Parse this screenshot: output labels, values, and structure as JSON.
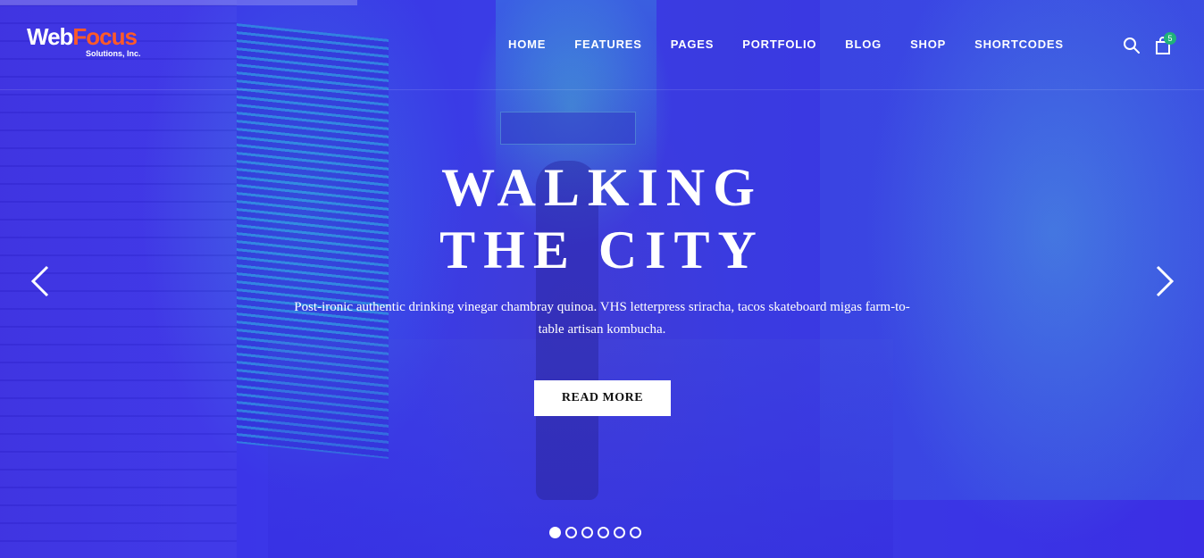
{
  "brand": {
    "name_part1": "Web",
    "name_part2": "Focus",
    "tagline": "Solutions, Inc.",
    "accent_color": "#ff5a28"
  },
  "nav": {
    "items": [
      "HOME",
      "FEATURES",
      "PAGES",
      "PORTFOLIO",
      "BLOG",
      "SHOP",
      "SHORTCODES"
    ]
  },
  "header_icons": {
    "search": "search-icon",
    "cart": "shopping-bag-icon",
    "cart_count": "5",
    "badge_color": "#20b27a"
  },
  "hero": {
    "title_line1": "WALKING",
    "title_line2": "THE CITY",
    "description": "Post-ironic authentic drinking vinegar chambray quinoa. VHS letterpress sriracha, tacos skateboard migas farm-to-table artisan kombucha.",
    "cta_label": "READ MORE",
    "overlay_color": "#3a35e5"
  },
  "slider": {
    "prev_icon": "chevron-left-icon",
    "next_icon": "chevron-right-icon",
    "slide_count": 6,
    "active_index": 0
  }
}
